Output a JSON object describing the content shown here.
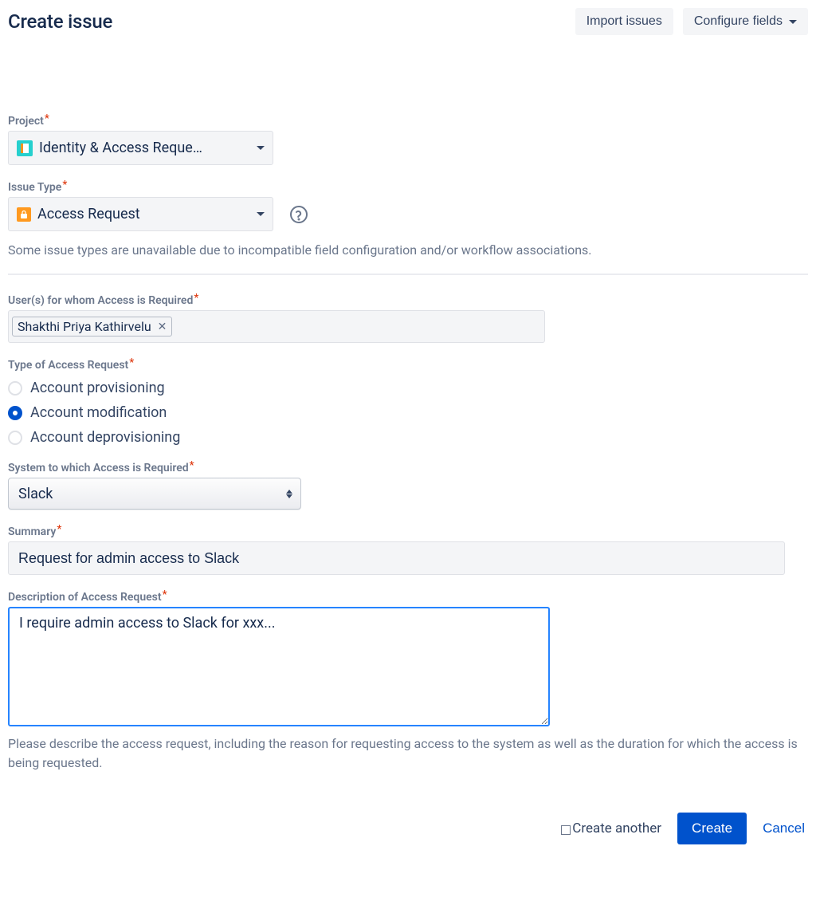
{
  "header": {
    "title": "Create issue",
    "import_button": "Import issues",
    "configure_button": "Configure fields"
  },
  "fields": {
    "project": {
      "label": "Project",
      "value": "Identity & Access Reque…"
    },
    "issue_type": {
      "label": "Issue Type",
      "value": "Access Request",
      "help_text": "Some issue types are unavailable due to incompatible field configuration and/or workflow associations."
    },
    "users": {
      "label": "User(s) for whom Access is Required",
      "chips": [
        "Shakthi Priya Kathirvelu"
      ]
    },
    "access_type": {
      "label": "Type of Access Request",
      "options": [
        {
          "label": "Account provisioning",
          "checked": false
        },
        {
          "label": "Account modification",
          "checked": true
        },
        {
          "label": "Account deprovisioning",
          "checked": false
        }
      ]
    },
    "system": {
      "label": "System to which Access is Required",
      "value": "Slack"
    },
    "summary": {
      "label": "Summary",
      "value": "Request for admin access to Slack"
    },
    "description": {
      "label": "Description of Access Request",
      "value": "I require admin access to Slack for xxx...",
      "help_text": "Please describe the access request, including the reason for requesting access to the system as well as the duration for which the access is being requested."
    }
  },
  "footer": {
    "create_another": "Create another",
    "create_button": "Create",
    "cancel_button": "Cancel"
  }
}
